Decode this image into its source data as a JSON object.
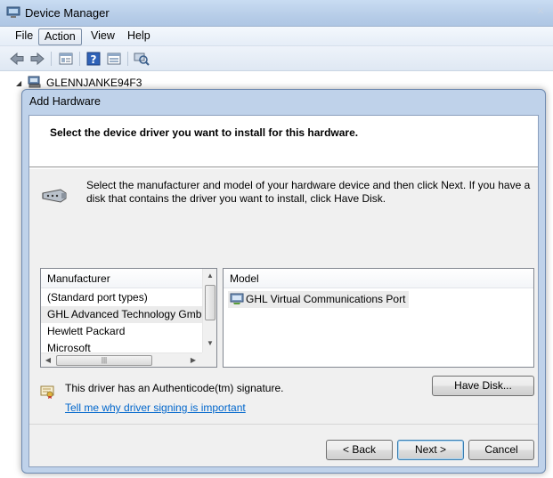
{
  "device_manager": {
    "title": "Device Manager",
    "menu": [
      {
        "label": "File"
      },
      {
        "label": "Action"
      },
      {
        "label": "View"
      },
      {
        "label": "Help"
      }
    ],
    "toolbar_icons": [
      "back-arrow-icon",
      "forward-arrow-icon",
      "properties-icon",
      "help-icon",
      "view-icon",
      "scan-hardware-icon"
    ],
    "tree": {
      "root": "GLENNJANKE94F3"
    }
  },
  "dialog": {
    "title": "Add Hardware",
    "header": "Select the device driver you want to install for this hardware.",
    "instructions": "Select the manufacturer and model of your hardware device and then click Next. If you have a disk that contains the driver you want to install, click Have Disk.",
    "manufacturer_list": {
      "header": "Manufacturer",
      "items": [
        {
          "label": "(Standard port types)"
        },
        {
          "label": "GHL Advanced Technology GmbH"
        },
        {
          "label": "Hewlett Packard"
        },
        {
          "label": "Microsoft"
        }
      ],
      "selected_index": 1
    },
    "model_list": {
      "header": "Model",
      "items": [
        {
          "label": "GHL Virtual Communications Port"
        }
      ]
    },
    "signature_text": "This driver has an Authenticode(tm) signature.",
    "signature_link": "Tell me why driver signing is important",
    "buttons": {
      "have_disk": "Have Disk...",
      "back": "< Back",
      "next": "Next >",
      "cancel": "Cancel"
    }
  },
  "colors": {
    "link": "#0066cc",
    "dialog_frame": "#bfd2ea",
    "selection": "#ebebeb"
  }
}
